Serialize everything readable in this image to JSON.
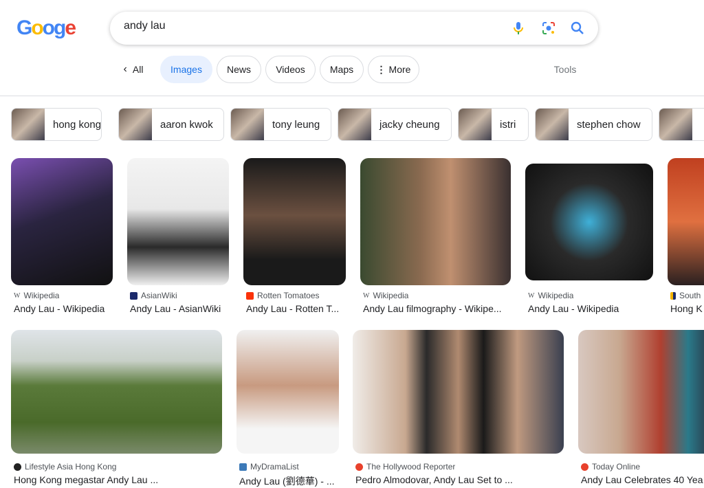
{
  "header": {
    "logo_text": "Google",
    "query": "andy lau"
  },
  "tabs": {
    "back": "All",
    "items": [
      "Images",
      "News",
      "Videos",
      "Maps",
      "More"
    ],
    "active": "Images",
    "tools": "Tools"
  },
  "chips": [
    "hong kong",
    "aaron kwok",
    "tony leung",
    "jacky cheung",
    "istri",
    "stephen chow",
    ""
  ],
  "results": [
    {
      "source": "Wikipedia",
      "title": "Andy Lau - Wikipedia",
      "fav": "#ffffff"
    },
    {
      "source": "AsianWiki",
      "title": "Andy Lau - AsianWiki",
      "fav": "#1b2a6b"
    },
    {
      "source": "Rotten Tomatoes",
      "title": "Andy Lau - Rotten T...",
      "fav": "#fa320a"
    },
    {
      "source": "Wikipedia",
      "title": "Andy Lau filmography - Wikipe...",
      "fav": "#ffffff"
    },
    {
      "source": "Wikipedia",
      "title": "Andy Lau - Wikipedia",
      "fav": "#ffffff"
    },
    {
      "source": "South",
      "title": "Hong K",
      "fav": "#f4b400"
    },
    {
      "source": "Lifestyle Asia Hong Kong",
      "title": "Hong Kong megastar Andy Lau ...",
      "fav": "#222222"
    },
    {
      "source": "MyDramaList",
      "title": "Andy Lau (劉德華) - ...",
      "fav": "#3d7ab8"
    },
    {
      "source": "The Hollywood Reporter",
      "title": "Pedro Almodovar, Andy Lau Set to ...",
      "fav": "#e8412c"
    },
    {
      "source": "Today Online",
      "title": "Andy Lau Celebrates 40 Yea",
      "fav": "#e8412c"
    }
  ]
}
